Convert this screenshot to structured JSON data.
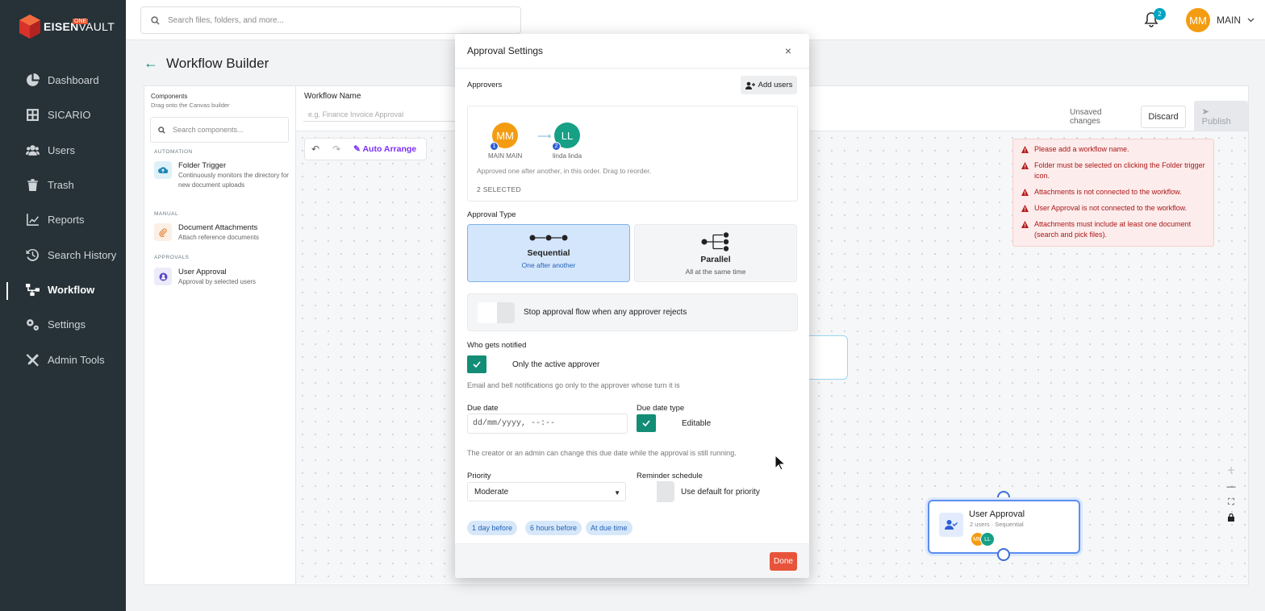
{
  "brand": {
    "name_bold": "EISEN",
    "name_rest": "VAULT",
    "edition": "ONE"
  },
  "sidebar": {
    "items": [
      {
        "label": "Dashboard",
        "icon": "pie-chart-icon"
      },
      {
        "label": "SICARIO",
        "icon": "grid-icon"
      },
      {
        "label": "Users",
        "icon": "users-icon"
      },
      {
        "label": "Trash",
        "icon": "trash-icon"
      },
      {
        "label": "Reports",
        "icon": "line-chart-icon"
      },
      {
        "label": "Search History",
        "icon": "history-icon"
      },
      {
        "label": "Workflow",
        "icon": "workflow-icon",
        "active": true
      },
      {
        "label": "Settings",
        "icon": "gears-icon"
      },
      {
        "label": "Admin Tools",
        "icon": "tools-icon"
      }
    ]
  },
  "topbar": {
    "search_placeholder": "Search files, folders, and more...",
    "notification_count": "2",
    "user_initials": "MM",
    "user_name": "MAIN"
  },
  "page": {
    "title": "Workflow Builder"
  },
  "components": {
    "title": "Components",
    "subtitle": "Drag onto the Canvas builder",
    "search_placeholder": "Search components...",
    "sections": [
      {
        "label": "AUTOMATION",
        "item": {
          "title": "Folder Trigger",
          "desc": "Continuously monitors the directory for new document uploads"
        }
      },
      {
        "label": "MANUAL",
        "item": {
          "title": "Document Attachments",
          "desc": "Attach reference documents"
        }
      },
      {
        "label": "APPROVALS",
        "item": {
          "title": "User Approval",
          "desc": "Approval by selected users"
        }
      }
    ]
  },
  "workflow": {
    "name_label": "Workflow Name",
    "name_placeholder": "e.g. Finance Invoice Approval",
    "auto_arrange": "Auto Arrange",
    "status": "Unsaved changes",
    "discard": "Discard",
    "publish": "Publish"
  },
  "errors": [
    "Please add a workflow name.",
    "Folder must be selected on clicking the Folder trigger icon.",
    "Attachments is not connected to the workflow.",
    "User Approval is not connected to the workflow.",
    "Attachments must include at least one document (search and pick files)."
  ],
  "node": {
    "title": "User Approval",
    "subtitle": "2 users · Sequential",
    "avatars": [
      "MM",
      "LL"
    ]
  },
  "modal": {
    "title": "Approval Settings",
    "approvers_label": "Approvers",
    "add_users": "Add users",
    "approvers": [
      {
        "initials": "MM",
        "name": "MAIN MAIN",
        "order": "1",
        "color": "#f39c12"
      },
      {
        "initials": "LL",
        "name": "linda linda",
        "order": "2",
        "color": "#16a085"
      }
    ],
    "approvers_note": "Approved one after another, in this order. Drag to reorder.",
    "selected_count": "2 SELECTED",
    "approval_type_label": "Approval Type",
    "types": [
      {
        "title": "Sequential",
        "desc": "One after another",
        "selected": true
      },
      {
        "title": "Parallel",
        "desc": "All at the same time",
        "selected": false
      }
    ],
    "stop_flow": {
      "label": "Stop approval flow when any approver rejects",
      "enabled": false
    },
    "notified_label": "Who gets notified",
    "notified_option": "Only the active approver",
    "notified_note": "Email and bell notifications go only to the approver whose turn it is",
    "due_date_label": "Due date",
    "due_date_value": "dd/mm/yyyy, --:--",
    "due_type_label": "Due date type",
    "due_type_option": "Editable",
    "due_note": "The creator or an admin can change this due date while the approval is still running.",
    "priority_label": "Priority",
    "priority_value": "Moderate",
    "reminder_label": "Reminder schedule",
    "reminder_option": "Use default for priority",
    "reminder_pills": [
      "1 day before",
      "6 hours before",
      "At due time"
    ],
    "done": "Done"
  }
}
